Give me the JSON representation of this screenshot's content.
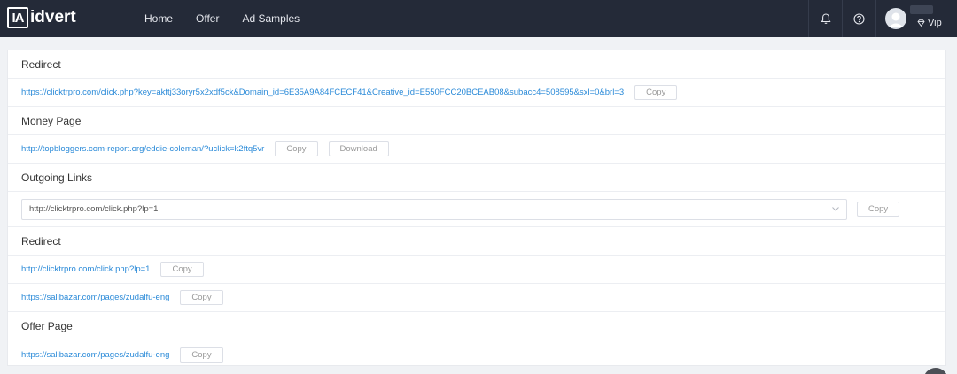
{
  "header": {
    "logo_mark": "IA",
    "logo_text": "idvert",
    "nav": [
      "Home",
      "Offer",
      "Ad Samples"
    ],
    "icons": [
      "bell-icon",
      "help-icon"
    ],
    "user_badge": "Vip",
    "colors": {
      "bg": "#242a38",
      "link": "#2a8ad8"
    }
  },
  "sections": {
    "redirect1": {
      "title": "Redirect",
      "url": "https://clicktrpro.com/click.php?key=akftj33oryr5x2xdf5ck&Domain_id=6E35A9A84FCECF41&Creative_id=E550FCC20BCEAB08&subacc4=508595&sxl=0&brl=3",
      "copy": "Copy"
    },
    "money": {
      "title": "Money Page",
      "url": "http://topbloggers.com-report.org/eddie-coleman/?uclick=k2ftq5vr",
      "copy": "Copy",
      "download": "Download"
    },
    "outgoing": {
      "title": "Outgoing Links",
      "selected": "http://clicktrpro.com/click.php?lp=1",
      "copy": "Copy"
    },
    "redirect2": {
      "title": "Redirect",
      "rows": [
        {
          "url": "http://clicktrpro.com/click.php?lp=1",
          "copy": "Copy"
        },
        {
          "url": "https://salibazar.com/pages/zudalfu-eng",
          "copy": "Copy"
        }
      ]
    },
    "offer": {
      "title": "Offer Page",
      "url": "https://salibazar.com/pages/zudalfu-eng",
      "copy": "Copy"
    }
  }
}
